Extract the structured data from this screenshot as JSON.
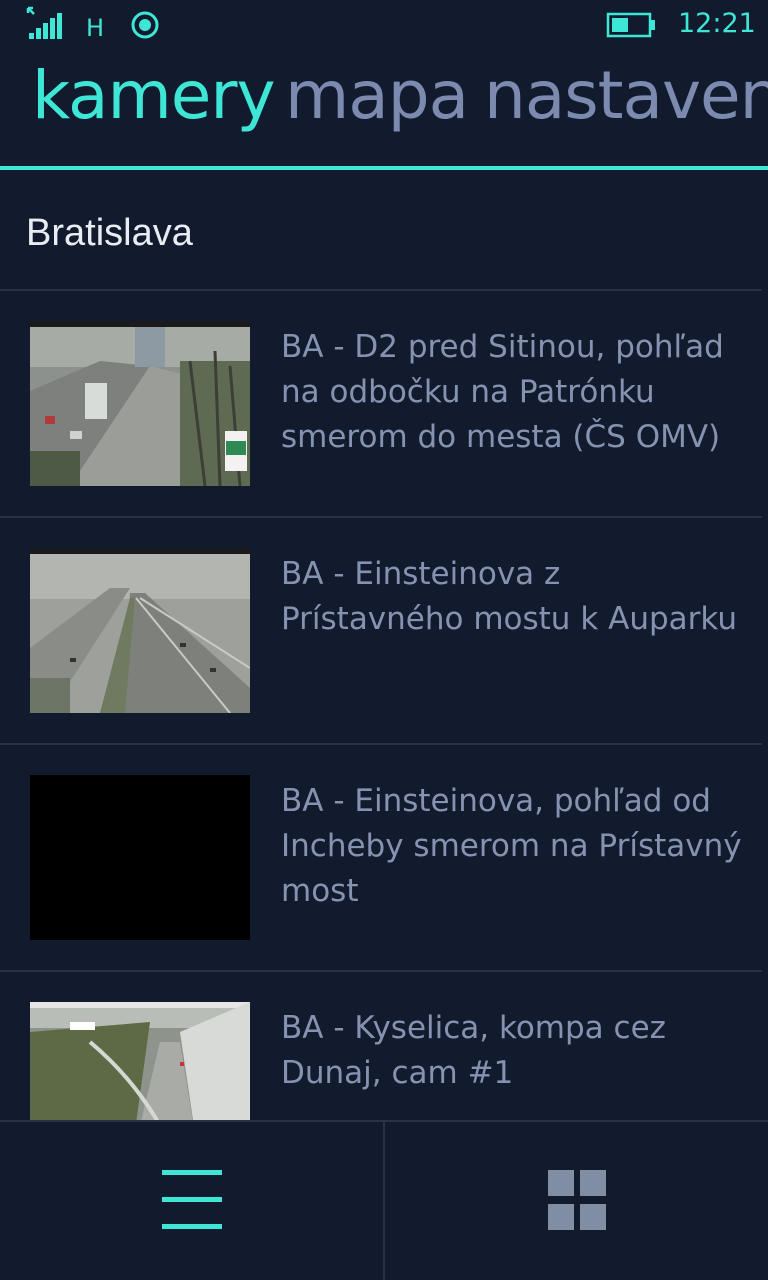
{
  "status_bar": {
    "network_type": "H",
    "time": "12:21",
    "icons": [
      "signal-icon",
      "location-icon",
      "battery-icon"
    ]
  },
  "pivot": {
    "tabs": [
      {
        "label": "kamery",
        "active": true
      },
      {
        "label": "mapa",
        "active": false
      },
      {
        "label": "nastavenia",
        "active": false
      }
    ],
    "accent_color": "#3ee6d6"
  },
  "group": {
    "title": "Bratislava"
  },
  "cameras": [
    {
      "title": "BA - D2 pred Sitinou, pohľad na odbočku na Patrónku smerom do mesta (ČS OMV)"
    },
    {
      "title": "BA - Einsteinova z Prístavného mostu k Auparku"
    },
    {
      "title": "BA - Einsteinova, pohľad od Incheby smerom na Prístavný most"
    },
    {
      "title": "BA - Kyselica, kompa cez Dunaj, cam #1"
    }
  ],
  "app_bar": {
    "buttons": [
      {
        "icon": "hamburger-menu-icon"
      },
      {
        "icon": "grid-view-icon"
      }
    ]
  },
  "colors": {
    "background": "#121b2d",
    "accent": "#3ee6d6",
    "inactive_text": "#7b8aae",
    "divider": "#273246"
  }
}
